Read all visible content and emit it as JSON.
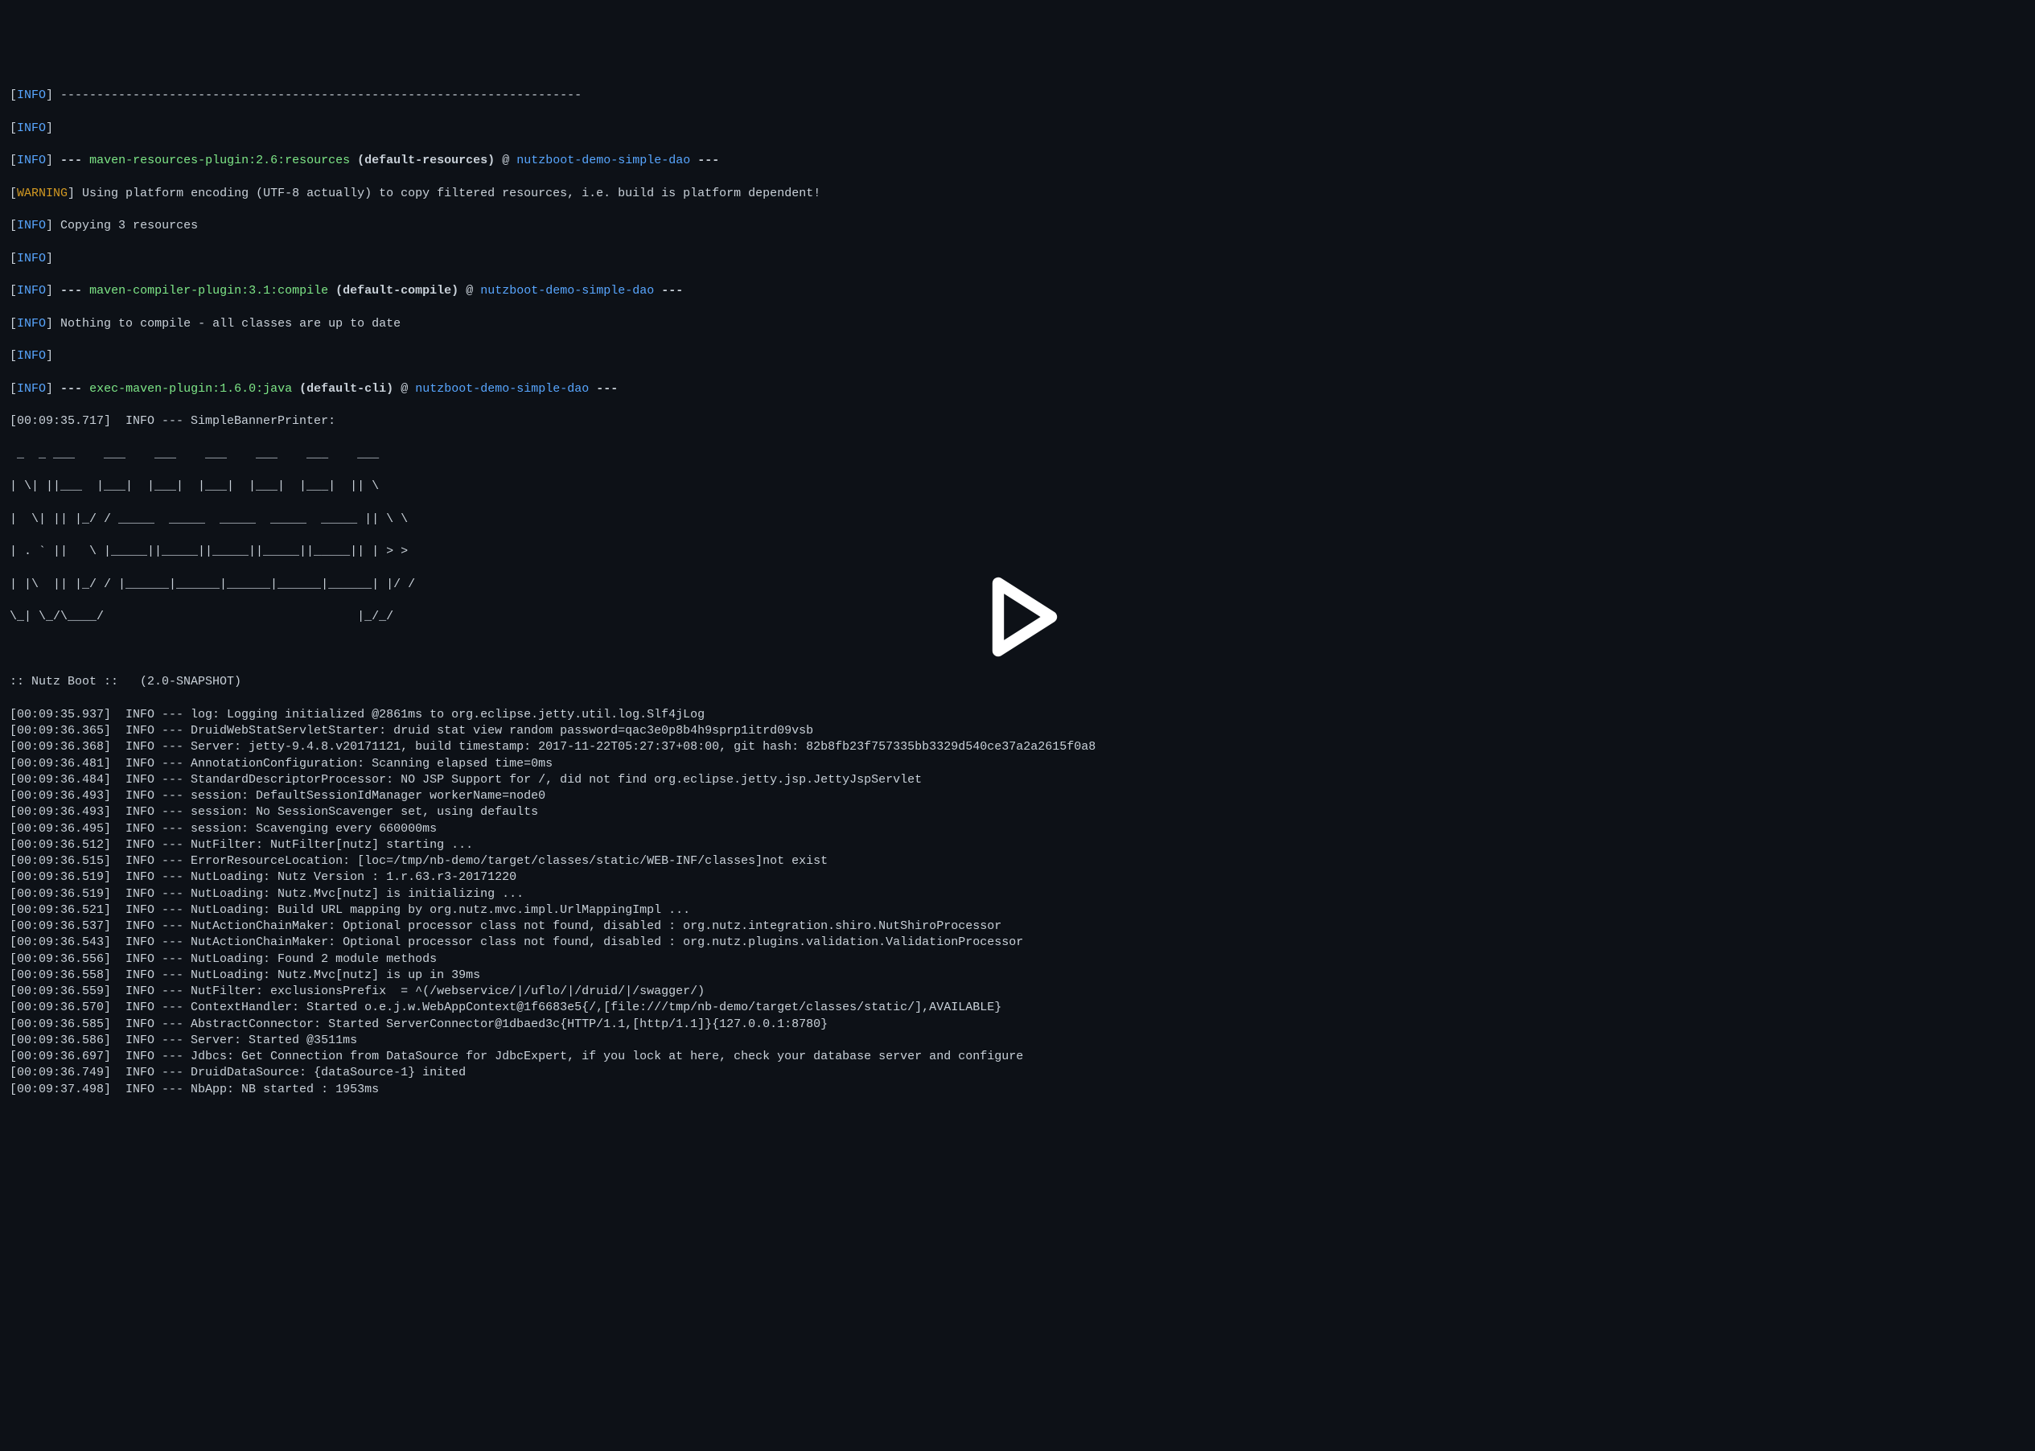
{
  "tags": {
    "info": "INFO",
    "warning": "WARNING"
  },
  "sep": "------------------------------------------------------------------------",
  "dash3": "---",
  "resources": {
    "plugin": "maven-resources-plugin:2.6:resources",
    "goal": "(default-resources)",
    "at": "@",
    "artifact": "nutzboot-demo-simple-dao"
  },
  "warnline": "Using platform encoding (UTF-8 actually) to copy filtered resources, i.e. build is platform dependent!",
  "copying": "Copying 3 resources",
  "compiler": {
    "plugin": "maven-compiler-plugin:3.1:compile",
    "goal": "(default-compile)",
    "at": "@",
    "artifact": "nutzboot-demo-simple-dao"
  },
  "nothing": "Nothing to compile - all classes are up to date",
  "exec": {
    "plugin": "exec-maven-plugin:1.6.0:java",
    "goal": "(default-cli)",
    "at": "@",
    "artifact": "nutzboot-demo-simple-dao"
  },
  "banner_header": "[00:09:35.717]  INFO --- SimpleBannerPrinter:",
  "ascii": [
    " _  _ ___    ___    ___    ___    ___    ___    ___",
    "| \\| ||___  |___|  |___|  |___|  |___|  |___|  || \\",
    "|  \\| || |_/ / _____  _____  _____  _____  _____ || \\ \\",
    "| . ` ||   \\ |_____||_____||_____||_____||_____|| | > >",
    "| |\\  || |_/ / |______|______|______|______|______| |/ /",
    "\\_| \\_/\\____/                                   |_/_/"
  ],
  "bootline": ":: Nutz Boot ::   (2.0-SNAPSHOT)",
  "logs": [
    "[00:09:35.937]  INFO --- log: Logging initialized @2861ms to org.eclipse.jetty.util.log.Slf4jLog",
    "[00:09:36.365]  INFO --- DruidWebStatServletStarter: druid stat view random password=qac3e0p8b4h9sprp1itrd09vsb",
    "[00:09:36.368]  INFO --- Server: jetty-9.4.8.v20171121, build timestamp: 2017-11-22T05:27:37+08:00, git hash: 82b8fb23f757335bb3329d540ce37a2a2615f0a8",
    "[00:09:36.481]  INFO --- AnnotationConfiguration: Scanning elapsed time=0ms",
    "[00:09:36.484]  INFO --- StandardDescriptorProcessor: NO JSP Support for /, did not find org.eclipse.jetty.jsp.JettyJspServlet",
    "[00:09:36.493]  INFO --- session: DefaultSessionIdManager workerName=node0",
    "[00:09:36.493]  INFO --- session: No SessionScavenger set, using defaults",
    "[00:09:36.495]  INFO --- session: Scavenging every 660000ms",
    "[00:09:36.512]  INFO --- NutFilter: NutFilter[nutz] starting ...",
    "[00:09:36.515]  INFO --- ErrorResourceLocation: [loc=/tmp/nb-demo/target/classes/static/WEB-INF/classes]not exist",
    "[00:09:36.519]  INFO --- NutLoading: Nutz Version : 1.r.63.r3-20171220",
    "[00:09:36.519]  INFO --- NutLoading: Nutz.Mvc[nutz] is initializing ...",
    "[00:09:36.521]  INFO --- NutLoading: Build URL mapping by org.nutz.mvc.impl.UrlMappingImpl ...",
    "[00:09:36.537]  INFO --- NutActionChainMaker: Optional processor class not found, disabled : org.nutz.integration.shiro.NutShiroProcessor",
    "[00:09:36.543]  INFO --- NutActionChainMaker: Optional processor class not found, disabled : org.nutz.plugins.validation.ValidationProcessor",
    "[00:09:36.556]  INFO --- NutLoading: Found 2 module methods",
    "[00:09:36.558]  INFO --- NutLoading: Nutz.Mvc[nutz] is up in 39ms",
    "[00:09:36.559]  INFO --- NutFilter: exclusionsPrefix  = ^(/webservice/|/uflo/|/druid/|/swagger/)",
    "[00:09:36.570]  INFO --- ContextHandler: Started o.e.j.w.WebAppContext@1f6683e5{/,[file:///tmp/nb-demo/target/classes/static/],AVAILABLE}",
    "[00:09:36.585]  INFO --- AbstractConnector: Started ServerConnector@1dbaed3c{HTTP/1.1,[http/1.1]}{127.0.0.1:8780}",
    "[00:09:36.586]  INFO --- Server: Started @3511ms",
    "[00:09:36.697]  INFO --- Jdbcs: Get Connection from DataSource for JdbcExpert, if you lock at here, check your database server and configure",
    "[00:09:36.749]  INFO --- DruidDataSource: {dataSource-1} inited",
    "[00:09:37.498]  INFO --- NbApp: NB started : 1953ms"
  ]
}
